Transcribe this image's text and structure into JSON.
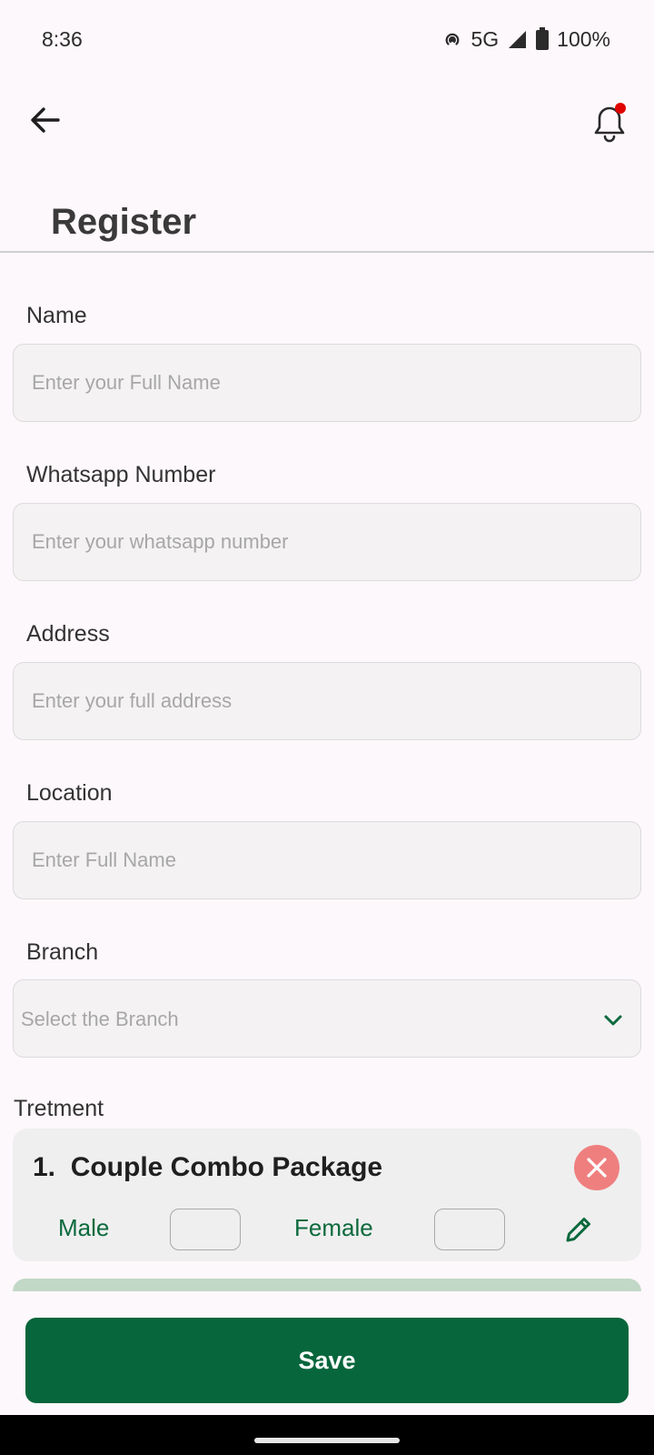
{
  "status_bar": {
    "time": "8:36",
    "network": "5G",
    "battery": "100%",
    "icons": [
      "hotspot-icon",
      "signal-icon",
      "battery-icon"
    ]
  },
  "app_bar": {
    "back_icon": "arrow-left-icon",
    "notification_icon": "bell-icon",
    "notification_dot_color": "#e00000"
  },
  "page": {
    "title": "Register"
  },
  "form": {
    "name": {
      "label": "Name",
      "placeholder": "Enter your Full Name",
      "value": ""
    },
    "whatsapp": {
      "label": "Whatsapp Number",
      "placeholder": "Enter your whatsapp number",
      "value": ""
    },
    "address": {
      "label": "Address",
      "placeholder": "Enter your full address",
      "value": ""
    },
    "location": {
      "label": "Location",
      "placeholder": "Enter Full Name",
      "value": ""
    },
    "branch": {
      "label": "Branch",
      "placeholder": "Select the Branch",
      "icon": "chevron-down-icon"
    }
  },
  "treatment": {
    "label": "Tretment",
    "items": [
      {
        "title": "1.  Couple Combo Package",
        "male_label": "Male",
        "male_count": "",
        "female_label": "Female",
        "female_count": "",
        "remove_icon": "close-circle-icon",
        "edit_icon": "pencil-icon"
      }
    ]
  },
  "actions": {
    "save_label": "Save"
  },
  "colors": {
    "primary": "#08663c",
    "accent_text": "#0c6a3d",
    "remove": "#ef7f7f",
    "background": "#fdf8fb"
  }
}
